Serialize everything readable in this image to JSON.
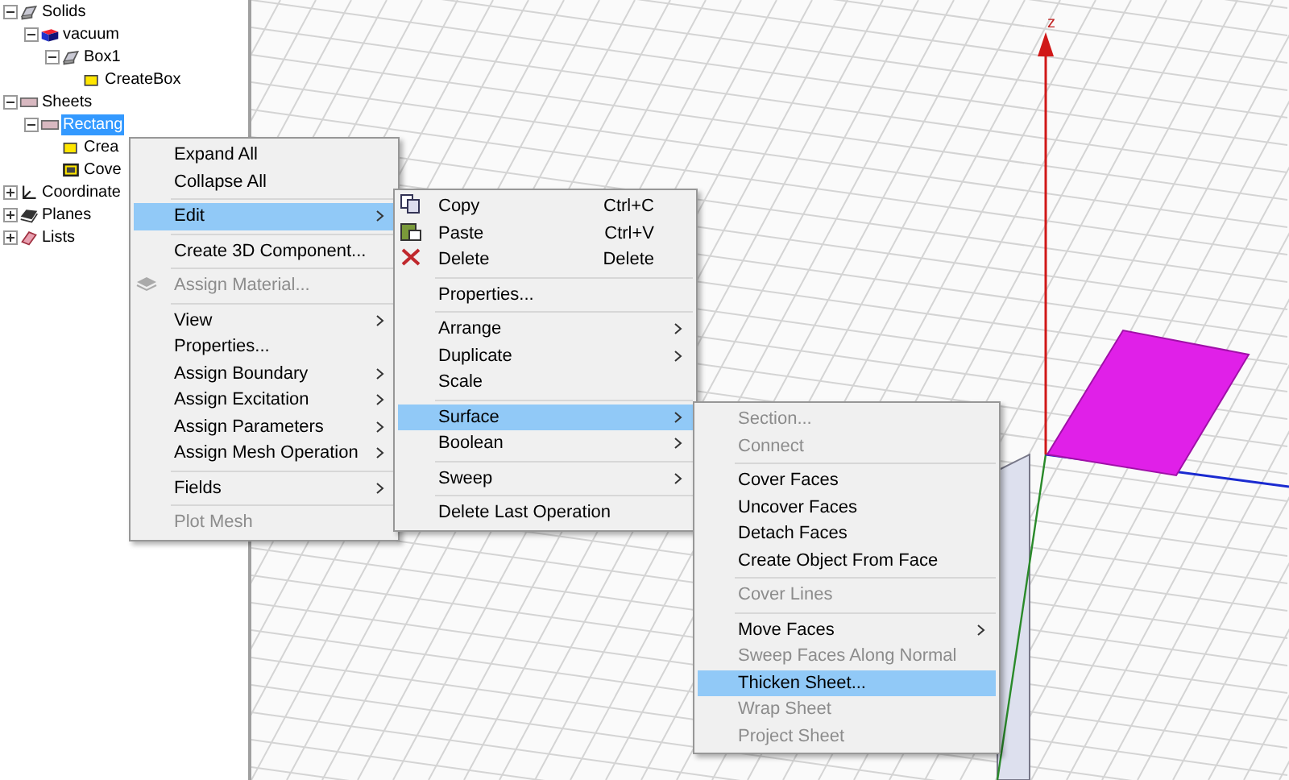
{
  "tree": [
    {
      "label": "Solids",
      "kind": "group",
      "expanded": true,
      "selected": false,
      "children": [
        {
          "label": "vacuum",
          "kind": "material",
          "expanded": true,
          "selected": false,
          "children": [
            {
              "label": "Box1",
              "kind": "group",
              "expanded": true,
              "selected": false,
              "children": [
                {
                  "label": "CreateBox",
                  "kind": "command",
                  "selected": false
                }
              ]
            }
          ]
        }
      ]
    },
    {
      "label": "Sheets",
      "kind": "sheet",
      "expanded": true,
      "selected": false,
      "children": [
        {
          "label": "Rectang",
          "kind": "sheet",
          "expanded": true,
          "selected": true,
          "children": [
            {
              "label": "Crea",
              "kind": "command",
              "selected": false
            },
            {
              "label": "Cove",
              "kind": "cover",
              "selected": false
            }
          ]
        }
      ]
    },
    {
      "label": "Coordinate",
      "kind": "axes",
      "expanded": false,
      "selected": false
    },
    {
      "label": "Planes",
      "kind": "plane",
      "expanded": false,
      "selected": false
    },
    {
      "label": "Lists",
      "kind": "list",
      "expanded": false,
      "selected": false
    }
  ],
  "viewport": {
    "axis_label": "z"
  },
  "menus": [
    {
      "items": [
        {
          "kind": "item",
          "label": "Expand All",
          "disabled": false,
          "selected": false,
          "submenu": false
        },
        {
          "kind": "item",
          "label": "Collapse All",
          "disabled": false,
          "selected": false,
          "submenu": false
        },
        {
          "kind": "separator"
        },
        {
          "kind": "item",
          "label": "Edit",
          "disabled": false,
          "selected": true,
          "submenu": true
        },
        {
          "kind": "separator"
        },
        {
          "kind": "item",
          "label": "Create 3D Component...",
          "disabled": false,
          "selected": false,
          "submenu": false
        },
        {
          "kind": "separator"
        },
        {
          "kind": "item",
          "label": "Assign Material...",
          "disabled": true,
          "selected": false,
          "submenu": false
        },
        {
          "kind": "separator"
        },
        {
          "kind": "item",
          "label": "View",
          "disabled": false,
          "selected": false,
          "submenu": true
        },
        {
          "kind": "item",
          "label": "Properties...",
          "disabled": false,
          "selected": false,
          "submenu": false
        },
        {
          "kind": "item",
          "label": "Assign Boundary",
          "disabled": false,
          "selected": false,
          "submenu": true
        },
        {
          "kind": "item",
          "label": "Assign Excitation",
          "disabled": false,
          "selected": false,
          "submenu": true
        },
        {
          "kind": "item",
          "label": "Assign Parameters",
          "disabled": false,
          "selected": false,
          "submenu": true
        },
        {
          "kind": "item",
          "label": "Assign Mesh Operation",
          "disabled": false,
          "selected": false,
          "submenu": true
        },
        {
          "kind": "separator"
        },
        {
          "kind": "item",
          "label": "Fields",
          "disabled": false,
          "selected": false,
          "submenu": true
        },
        {
          "kind": "separator"
        },
        {
          "kind": "item",
          "label": "Plot Mesh",
          "disabled": true,
          "selected": false,
          "submenu": false
        }
      ]
    },
    {
      "items": [
        {
          "kind": "item",
          "label": "Copy",
          "shortcut": "Ctrl+C",
          "disabled": false,
          "selected": false,
          "submenu": false
        },
        {
          "kind": "item",
          "label": "Paste",
          "shortcut": "Ctrl+V",
          "disabled": false,
          "selected": false,
          "submenu": false
        },
        {
          "kind": "item",
          "label": "Delete",
          "shortcut": "Delete",
          "disabled": false,
          "selected": false,
          "submenu": false
        },
        {
          "kind": "separator"
        },
        {
          "kind": "item",
          "label": "Properties...",
          "disabled": false,
          "selected": false,
          "submenu": false
        },
        {
          "kind": "separator"
        },
        {
          "kind": "item",
          "label": "Arrange",
          "disabled": false,
          "selected": false,
          "submenu": true
        },
        {
          "kind": "item",
          "label": "Duplicate",
          "disabled": false,
          "selected": false,
          "submenu": true
        },
        {
          "kind": "item",
          "label": "Scale",
          "disabled": false,
          "selected": false,
          "submenu": false
        },
        {
          "kind": "separator"
        },
        {
          "kind": "item",
          "label": "Surface",
          "disabled": false,
          "selected": true,
          "submenu": true
        },
        {
          "kind": "item",
          "label": "Boolean",
          "disabled": false,
          "selected": false,
          "submenu": true
        },
        {
          "kind": "separator"
        },
        {
          "kind": "item",
          "label": "Sweep",
          "disabled": false,
          "selected": false,
          "submenu": true
        },
        {
          "kind": "separator"
        },
        {
          "kind": "item",
          "label": "Delete Last Operation",
          "disabled": false,
          "selected": false,
          "submenu": false
        }
      ]
    },
    {
      "items": [
        {
          "kind": "item",
          "label": "Section...",
          "disabled": true,
          "selected": false,
          "submenu": false
        },
        {
          "kind": "item",
          "label": "Connect",
          "disabled": true,
          "selected": false,
          "submenu": false
        },
        {
          "kind": "separator"
        },
        {
          "kind": "item",
          "label": "Cover Faces",
          "disabled": false,
          "selected": false,
          "submenu": false
        },
        {
          "kind": "item",
          "label": "Uncover Faces",
          "disabled": false,
          "selected": false,
          "submenu": false
        },
        {
          "kind": "item",
          "label": "Detach Faces",
          "disabled": false,
          "selected": false,
          "submenu": false
        },
        {
          "kind": "item",
          "label": "Create Object From Face",
          "disabled": false,
          "selected": false,
          "submenu": false
        },
        {
          "kind": "separator"
        },
        {
          "kind": "item",
          "label": "Cover Lines",
          "disabled": true,
          "selected": false,
          "submenu": false
        },
        {
          "kind": "separator"
        },
        {
          "kind": "item",
          "label": "Move Faces",
          "disabled": false,
          "selected": false,
          "submenu": true
        },
        {
          "kind": "item",
          "label": "Sweep Faces Along Normal",
          "disabled": true,
          "selected": false,
          "submenu": false
        },
        {
          "kind": "item",
          "label": "Thicken Sheet...",
          "disabled": false,
          "selected": true,
          "submenu": false
        },
        {
          "kind": "item",
          "label": "Wrap Sheet",
          "disabled": true,
          "selected": false,
          "submenu": false
        },
        {
          "kind": "item",
          "label": "Project Sheet",
          "disabled": true,
          "selected": false,
          "submenu": false
        }
      ]
    }
  ]
}
